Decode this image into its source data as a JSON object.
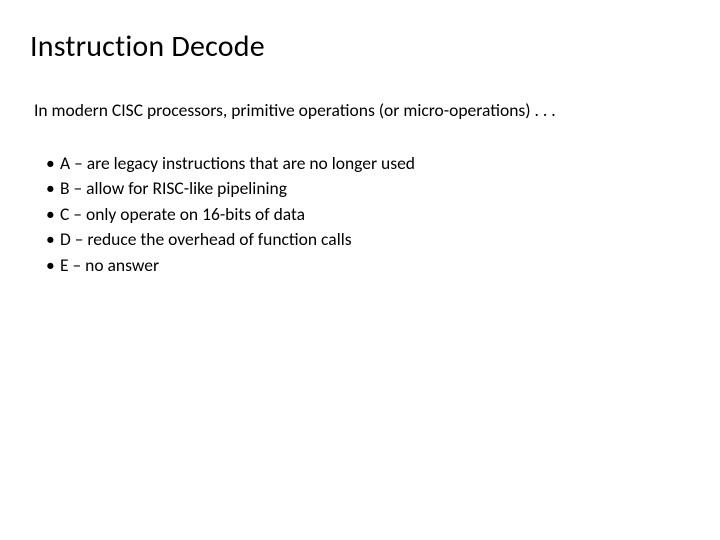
{
  "slide": {
    "title": "Instruction Decode",
    "question": "In modern CISC processors, primitive operations (or micro-operations) . . .",
    "options": [
      "A – are legacy instructions that are no longer used",
      "B – allow for RISC-like pipelining",
      "C – only operate on 16-bits of data",
      "D – reduce the overhead of function calls",
      "E – no answer"
    ]
  }
}
